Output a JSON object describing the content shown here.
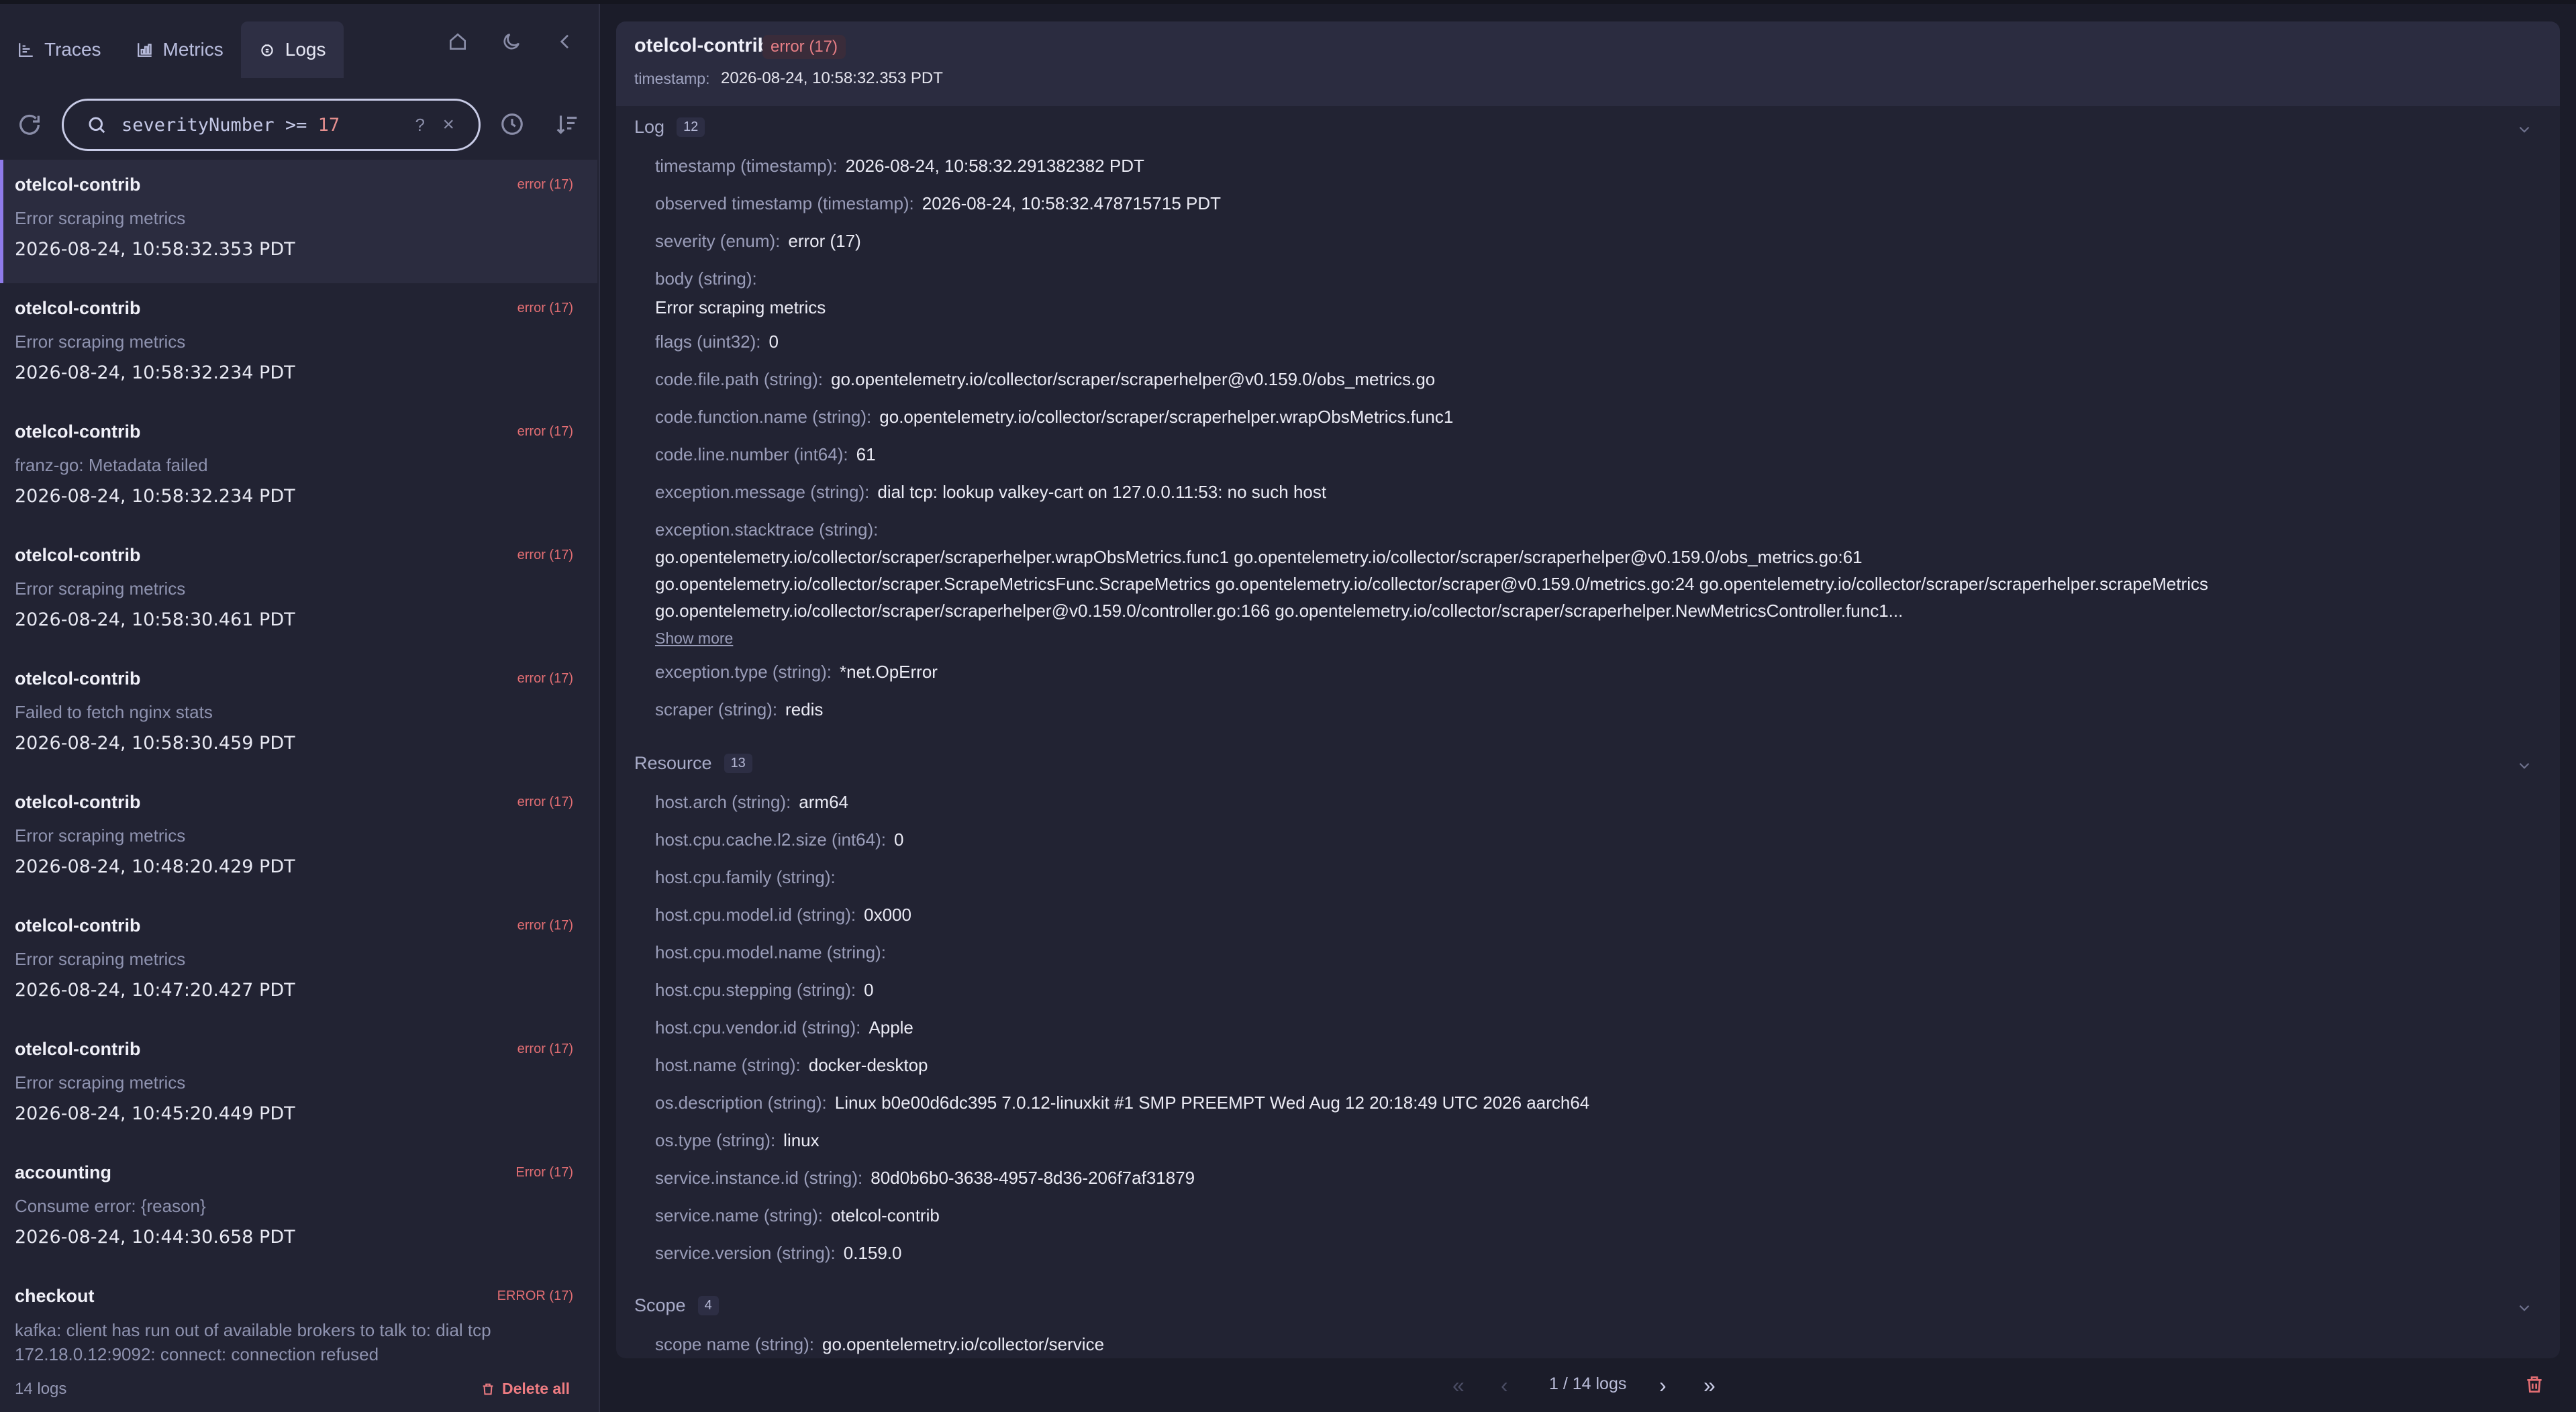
{
  "tabs": [
    {
      "label": "Traces",
      "icon": "chart-icon"
    },
    {
      "label": "Metrics",
      "icon": "bar-chart-icon"
    },
    {
      "label": "Logs",
      "icon": "logs-icon"
    }
  ],
  "search": {
    "prefix": "severityNumber >= ",
    "number": "17",
    "help": "?"
  },
  "logs": [
    {
      "service": "otelcol-contrib",
      "severity": "error (17)",
      "message": "Error scraping metrics",
      "timestamp": "2026-08-24, 10:58:32.353 PDT"
    },
    {
      "service": "otelcol-contrib",
      "severity": "error (17)",
      "message": "Error scraping metrics",
      "timestamp": "2026-08-24, 10:58:32.234 PDT"
    },
    {
      "service": "otelcol-contrib",
      "severity": "error (17)",
      "message": "franz-go: Metadata failed",
      "timestamp": "2026-08-24, 10:58:32.234 PDT"
    },
    {
      "service": "otelcol-contrib",
      "severity": "error (17)",
      "message": "Error scraping metrics",
      "timestamp": "2026-08-24, 10:58:30.461 PDT"
    },
    {
      "service": "otelcol-contrib",
      "severity": "error (17)",
      "message": "Failed to fetch nginx stats",
      "timestamp": "2026-08-24, 10:58:30.459 PDT"
    },
    {
      "service": "otelcol-contrib",
      "severity": "error (17)",
      "message": "Error scraping metrics",
      "timestamp": "2026-08-24, 10:48:20.429 PDT"
    },
    {
      "service": "otelcol-contrib",
      "severity": "error (17)",
      "message": "Error scraping metrics",
      "timestamp": "2026-08-24, 10:47:20.427 PDT"
    },
    {
      "service": "otelcol-contrib",
      "severity": "error (17)",
      "message": "Error scraping metrics",
      "timestamp": "2026-08-24, 10:45:20.449 PDT"
    },
    {
      "service": "accounting",
      "severity": "Error (17)",
      "message": "Consume error: {reason}",
      "timestamp": "2026-08-24, 10:44:30.658 PDT"
    },
    {
      "service": "checkout",
      "severity": "ERROR (17)",
      "message": "kafka: client has run out of available brokers to talk to: dial tcp 172.18.0.12:9092: connect: connection refused",
      "timestamp": ""
    }
  ],
  "footer": {
    "count": "14 logs",
    "delete_all": "Delete all"
  },
  "detail": {
    "service": "otelcol-contrib",
    "badge": "error (17)",
    "timestamp_label": "timestamp:",
    "timestamp": "2026-08-24, 10:58:32.353 PDT",
    "log_section": {
      "title": "Log",
      "count": "12"
    },
    "log_rows": [
      {
        "k": "timestamp (timestamp):",
        "v": "2026-08-24, 10:58:32.291382382 PDT"
      },
      {
        "k": "observed timestamp (timestamp):",
        "v": "2026-08-24, 10:58:32.478715715 PDT"
      },
      {
        "k": "severity (enum):",
        "v": "error (17)"
      },
      {
        "k": "body (string):",
        "v": ""
      },
      {
        "k": "flags (uint32):",
        "v": "0"
      },
      {
        "k": "code.file.path (string):",
        "v": "go.opentelemetry.io/collector/scraper/scraperhelper@v0.159.0/obs_metrics.go"
      },
      {
        "k": "code.function.name (string):",
        "v": "go.opentelemetry.io/collector/scraper/scraperhelper.wrapObsMetrics.func1"
      },
      {
        "k": "code.line.number (int64):",
        "v": "61"
      },
      {
        "k": "exception.message (string):",
        "v": "dial tcp: lookup valkey-cart on 127.0.0.11:53: no such host"
      },
      {
        "k": "exception.stacktrace (string):",
        "v": ""
      },
      {
        "k": "exception.type (string):",
        "v": "*net.OpError"
      },
      {
        "k": "scraper (string):",
        "v": "redis"
      }
    ],
    "body_value": "Error scraping metrics",
    "stacktrace": [
      "go.opentelemetry.io/collector/scraper/scraperhelper.wrapObsMetrics.func1 go.opentelemetry.io/collector/scraper/scraperhelper@v0.159.0/obs_metrics.go:61",
      "go.opentelemetry.io/collector/scraper.ScrapeMetricsFunc.ScrapeMetrics go.opentelemetry.io/collector/scraper@v0.159.0/metrics.go:24 go.opentelemetry.io/collector/scraper/scraperhelper.scrapeMetrics",
      "go.opentelemetry.io/collector/scraper/scraperhelper@v0.159.0/controller.go:166 go.opentelemetry.io/collector/scraper/scraperhelper.NewMetricsController.func1..."
    ],
    "show_more": "Show more",
    "resource_section": {
      "title": "Resource",
      "count": "13"
    },
    "resource_rows": [
      {
        "k": "host.arch (string):",
        "v": "arm64"
      },
      {
        "k": "host.cpu.cache.l2.size (int64):",
        "v": "0"
      },
      {
        "k": "host.cpu.family (string):",
        "v": ""
      },
      {
        "k": "host.cpu.model.id (string):",
        "v": "0x000"
      },
      {
        "k": "host.cpu.model.name (string):",
        "v": ""
      },
      {
        "k": "host.cpu.stepping (string):",
        "v": "0"
      },
      {
        "k": "host.cpu.vendor.id (string):",
        "v": "Apple"
      },
      {
        "k": "host.name (string):",
        "v": "docker-desktop"
      },
      {
        "k": "os.description (string):",
        "v": "Linux b0e00d6dc395 7.0.12-linuxkit #1 SMP PREEMPT Wed Aug 12 20:18:49 UTC 2026 aarch64"
      },
      {
        "k": "os.type (string):",
        "v": "linux"
      },
      {
        "k": "service.instance.id (string):",
        "v": "80d0b6b0-3638-4957-8d36-206f7af31879"
      },
      {
        "k": "service.name (string):",
        "v": "otelcol-contrib"
      },
      {
        "k": "service.version (string):",
        "v": "0.159.0"
      }
    ],
    "scope_section": {
      "title": "Scope",
      "count": "4"
    },
    "scope_rows": [
      {
        "k": "scope name (string):",
        "v": "go.opentelemetry.io/collector/service"
      }
    ]
  },
  "pager": {
    "text": "1 / 14 logs"
  },
  "colors": {
    "accent": "#8f7bea",
    "error": "#e36e73",
    "bg": "#1b1c29",
    "panel": "#222333"
  }
}
